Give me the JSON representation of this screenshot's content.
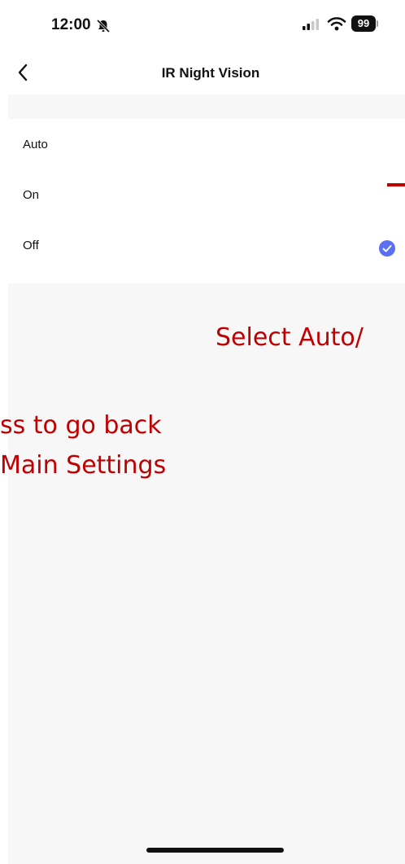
{
  "status_bar": {
    "time": "12:00",
    "battery": "99",
    "icons": [
      "bell-slash-icon",
      "cellular-signal-icon",
      "wifi-icon",
      "battery-icon"
    ]
  },
  "nav": {
    "back_icon": "chevron-left-icon",
    "title": "IR Night Vision"
  },
  "options": [
    {
      "label": "Auto",
      "selected": false
    },
    {
      "label": "On",
      "selected": false
    },
    {
      "label": "Off",
      "selected": true
    }
  ],
  "selected_icon": "checkmark-circle-icon",
  "colors": {
    "accent": "#5b6ff2",
    "annotation": "#c00000",
    "background": "#f7f7f7"
  },
  "annotations": {
    "select_hint": "Select Auto/",
    "back_hint_line1": "ss to go back",
    "back_hint_line2": "Main Settings"
  }
}
